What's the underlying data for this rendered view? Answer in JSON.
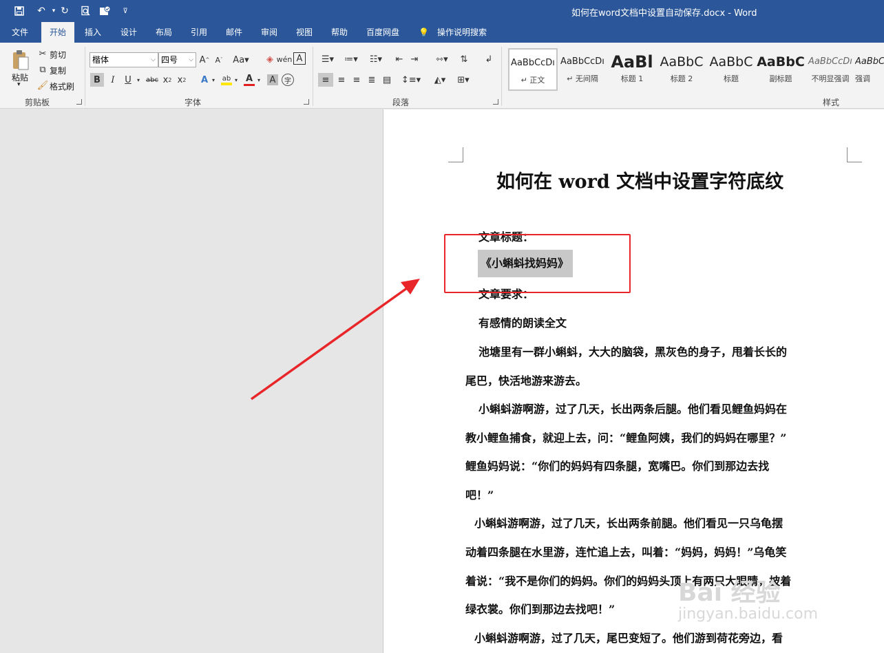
{
  "window": {
    "title": "如何在word文档中设置自动保存.docx - Word"
  },
  "quick_access": {
    "icons": [
      "save-icon",
      "undo-icon",
      "redo-icon",
      "print-preview-icon",
      "template-icon",
      "customize-icon"
    ]
  },
  "tabs": [
    {
      "label": "文件",
      "active": false
    },
    {
      "label": "开始",
      "active": true
    },
    {
      "label": "插入",
      "active": false
    },
    {
      "label": "设计",
      "active": false
    },
    {
      "label": "布局",
      "active": false
    },
    {
      "label": "引用",
      "active": false
    },
    {
      "label": "邮件",
      "active": false
    },
    {
      "label": "审阅",
      "active": false
    },
    {
      "label": "视图",
      "active": false
    },
    {
      "label": "帮助",
      "active": false
    },
    {
      "label": "百度网盘",
      "active": false
    },
    {
      "label": "操作说明搜索",
      "active": false
    }
  ],
  "clipboard": {
    "paste": "粘贴",
    "cut": "剪切",
    "copy": "复制",
    "format_painter": "格式刷",
    "group_label": "剪贴板"
  },
  "font": {
    "name": "楷体",
    "size": "四号",
    "group_label": "字体",
    "font_color": "#e02020",
    "highlight_color": "#ffe600"
  },
  "paragraph": {
    "group_label": "段落"
  },
  "styles": {
    "group_label": "样式",
    "items": [
      {
        "sample": "AaBbCcDı",
        "name": "↵ 正文"
      },
      {
        "sample": "AaBbCcDı",
        "name": "↵ 无间隔"
      },
      {
        "sample": "AaBl",
        "name": "标题 1"
      },
      {
        "sample": "AaBbC",
        "name": "标题 2"
      },
      {
        "sample": "AaBbC",
        "name": "标题"
      },
      {
        "sample": "AaBbC",
        "name": "副标题"
      },
      {
        "sample": "AaBbCcDı",
        "name": "不明显强调"
      },
      {
        "sample": "AaBbCc",
        "name": "强调"
      }
    ]
  },
  "document": {
    "title": "如何在 word 文档中设置字符底纹",
    "lines": [
      "文章标题：",
      "《小蝌蚪找妈妈》",
      "文章要求：",
      "有感情的朗读全文",
      "池塘里有一群小蝌蚪，大大的脑袋，黑灰色的身子，甩着长长的",
      "尾巴，快活地游来游去。",
      "小蝌蚪游啊游，过了几天，长出两条后腿。他们看见鲤鱼妈妈在",
      "教小鲤鱼捕食，就迎上去，问：“鲤鱼阿姨，我们的妈妈在哪里？”",
      "鲤鱼妈妈说：“你们的妈妈有四条腿，宽嘴巴。你们到那边去找",
      "吧！”",
      "小蝌蚪游啊游，过了几天，长出两条前腿。他们看见一只乌龟摆",
      "动着四条腿在水里游，连忙追上去，叫着：“妈妈，妈妈！”乌龟笑",
      "着说：“我不是你们的妈妈。你们的妈妈头顶上有两只大眼睛，披着",
      "绿衣裳。你们到那边去找吧！”",
      "小蝌蚪游啊游，过了几天，尾巴变短了。他们游到荷花旁边，看"
    ],
    "shaded_color": "#c8c8c8"
  },
  "annotation": {
    "color": "#e8262a"
  },
  "watermark": {
    "logo": "Bai 经验",
    "url": "jingyan.baidu.com"
  }
}
